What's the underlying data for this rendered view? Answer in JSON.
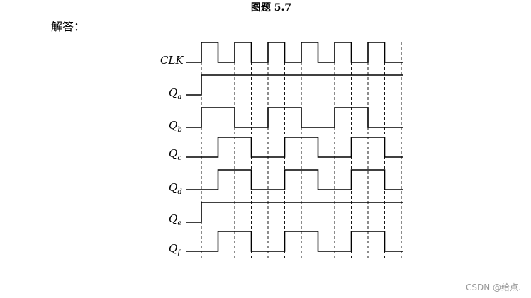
{
  "figure": {
    "caption": "图题 5.7",
    "answer_label": "解答："
  },
  "watermark": "CSDN @给点.",
  "timing": {
    "period": 47,
    "cycles": 6,
    "signals": [
      {
        "name": "CLK",
        "label": "CLK",
        "sub": "",
        "kind": "clock"
      },
      {
        "name": "Qa",
        "label": "Q",
        "sub": "a",
        "kind": "wave",
        "start": 0,
        "toggles": [
          0
        ]
      },
      {
        "name": "Qb",
        "label": "Q",
        "sub": "b",
        "kind": "wave",
        "start": 0,
        "toggles": [
          0,
          1,
          2,
          3,
          4,
          5
        ]
      },
      {
        "name": "Qc",
        "label": "Q",
        "sub": "c",
        "kind": "wave",
        "start": 0,
        "toggles": [
          0.5,
          1.5,
          2.5,
          3.5,
          4.5,
          5.5
        ]
      },
      {
        "name": "Qd",
        "label": "Q",
        "sub": "d",
        "kind": "wave",
        "start": 0,
        "toggles": [
          0.5,
          1.5,
          2.5,
          3.5,
          4.5,
          5.5
        ]
      },
      {
        "name": "Qe",
        "label": "Q",
        "sub": "e",
        "kind": "wave",
        "start": 0,
        "toggles": [
          0
        ]
      },
      {
        "name": "Qf",
        "label": "Q",
        "sub": "f",
        "kind": "wave",
        "start": 0,
        "toggles": [
          0.5,
          1.5,
          2.5,
          3.5,
          4.5,
          5.5
        ]
      }
    ]
  }
}
